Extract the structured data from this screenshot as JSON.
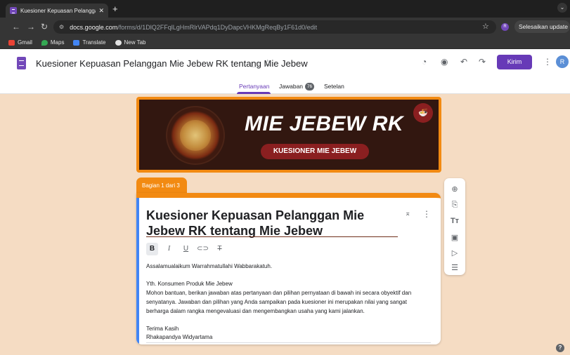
{
  "browser": {
    "tab_title": "Kuesioner Kepuasan Pelangga",
    "tab_close": "✕",
    "new_tab": "+",
    "tab_menu": "⌄",
    "url_host": "docs.google.com",
    "url_path": "/forms/d/1DlQ2FFqlLgHmRlrVAPdq1DyDapcVHKMgReqBy1F61d0/edit",
    "profile_initial": "R",
    "update_label": "Selesaikan update ⋮",
    "bookmarks": [
      "Gmail",
      "Maps",
      "Translate",
      "New Tab"
    ]
  },
  "header": {
    "form_title": "Kuesioner Kepuasan Pelanggan Mie Jebew RK tentang Mie Jebew",
    "send_label": "Kirim",
    "user_initial": "R"
  },
  "tabs": {
    "questions": "Pertanyaan",
    "responses": "Jawaban",
    "responses_count": "76",
    "settings": "Setelan"
  },
  "banner": {
    "title": "MIE JEBEW RK",
    "subtitle": "KUESIONER MIE JEBEW"
  },
  "section": {
    "label": "Bagian 1 dari 3",
    "title": "Kuesioner Kepuasan Pelanggan Mie Jebew RK tentang Mie Jebew",
    "description": [
      "Assalamualaikum Warrahmatullahi Wabbarakatuh.",
      "Yth. Konsumen Produk Mie Jebew",
      "Mohon bantuan, berikan jawaban atas pertanyaan dan pilihan pernyataan di bawah ini secara obyektif dan",
      "senyatanya. Jawaban dan pilihan yang Anda sampaikan pada kuesioner ini merupakan nilai yang sangat",
      "berharga dalam rangka mengevaluasi dan mengembangkan usaha yang kami jalankan.",
      "Terima Kasih",
      "Rhakapandya Widyartama"
    ]
  },
  "colors": {
    "accent": "#673ab7",
    "theme": "#f28a12",
    "background": "#f5dcc3",
    "banner_bg": "#321710"
  }
}
